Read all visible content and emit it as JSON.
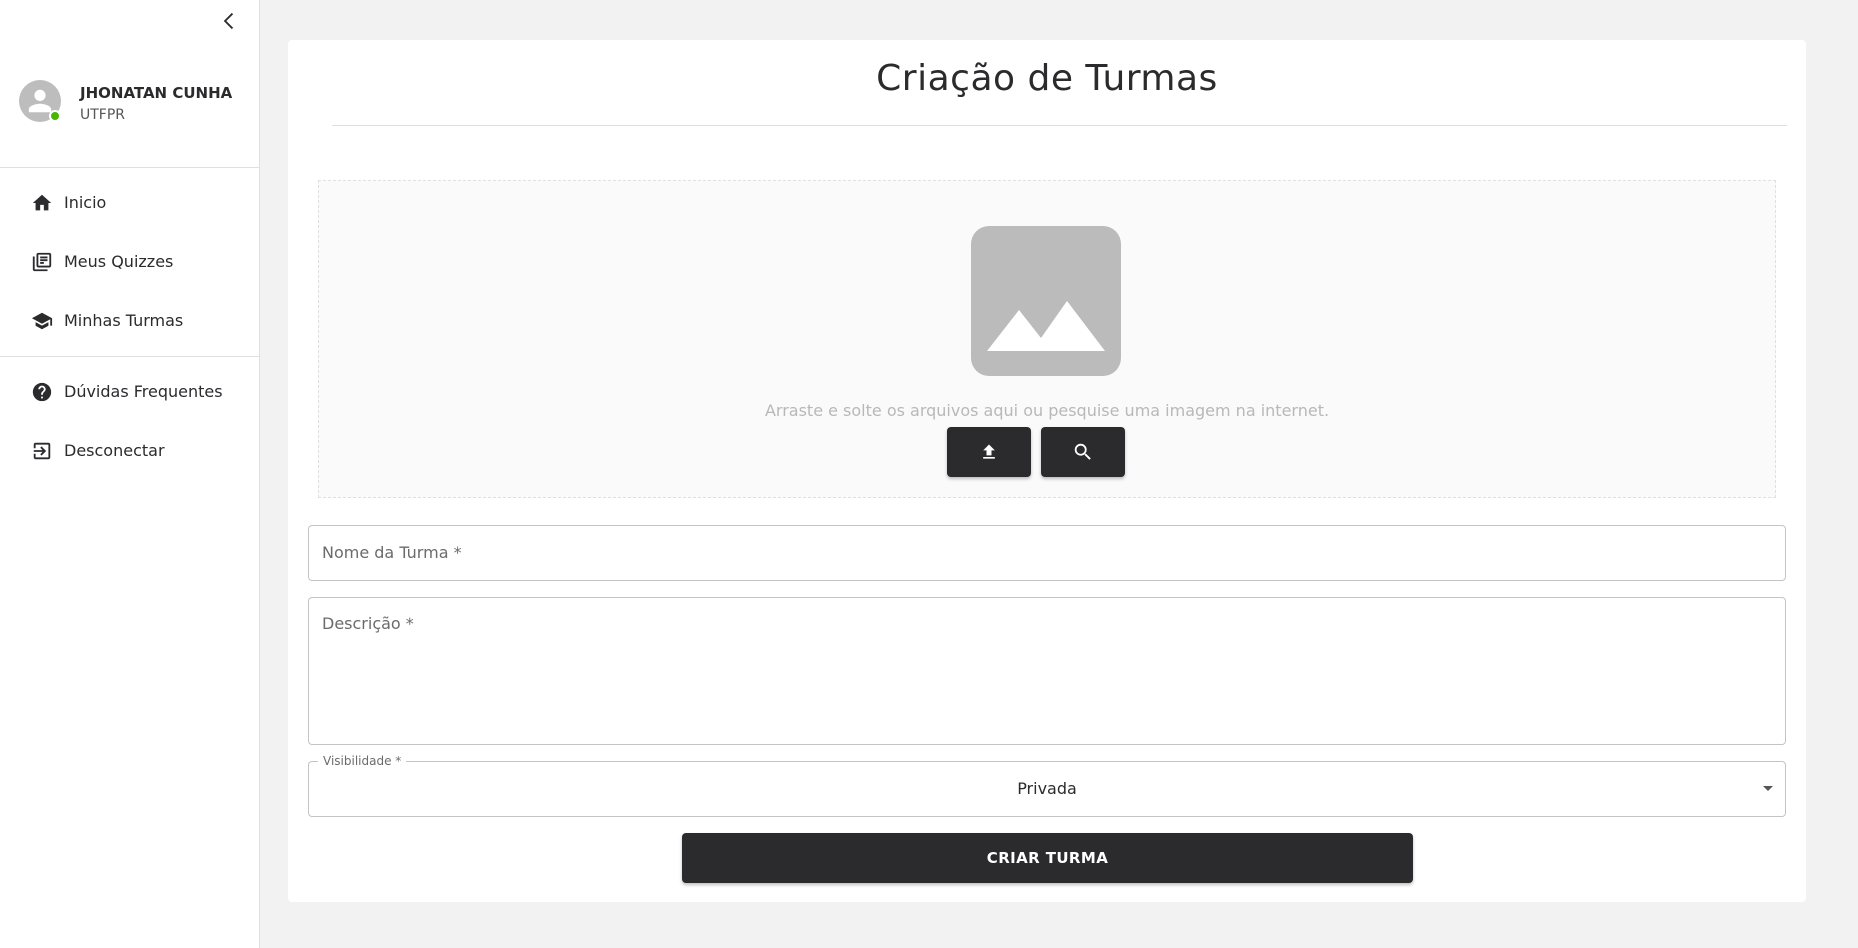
{
  "sidebar": {
    "collapse_icon": "chevron-left-icon",
    "user": {
      "name": "JHONATAN CUNHA",
      "organization": "UTFPR",
      "status_color": "#44b700"
    },
    "nav_main": [
      {
        "label": "Inicio",
        "icon": "home-icon"
      },
      {
        "label": "Meus Quizzes",
        "icon": "library-books-icon"
      },
      {
        "label": "Minhas Turmas",
        "icon": "school-icon"
      }
    ],
    "nav_secondary": [
      {
        "label": "Dúvidas Frequentes",
        "icon": "help-circle-icon"
      },
      {
        "label": "Desconectar",
        "icon": "logout-icon"
      }
    ]
  },
  "main": {
    "title": "Criação de Turmas",
    "dropzone": {
      "placeholder_icon": "image-icon",
      "text": "Arraste e solte os arquivos aqui ou pesquise uma imagem na internet.",
      "upload_icon": "upload-icon",
      "search_icon": "search-icon"
    },
    "form": {
      "name_label": "Nome da Turma *",
      "description_label": "Descrição *",
      "visibility_label": "Visibilidade *",
      "visibility_value": "Privada",
      "submit_label": "CRIAR TURMA"
    }
  },
  "colors": {
    "accent": "#2b2b2e",
    "background": "#f2f2f2",
    "card": "#ffffff"
  }
}
